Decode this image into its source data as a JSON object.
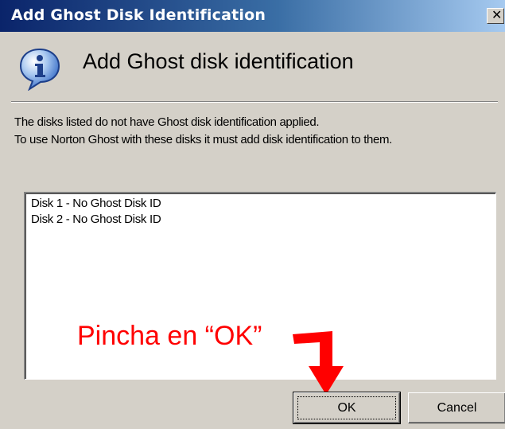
{
  "window": {
    "title": "Add Ghost Disk Identification",
    "close_glyph": "✕"
  },
  "header": {
    "icon": "info-icon",
    "title": "Add Ghost disk identification"
  },
  "description": {
    "line1": "The disks listed do not have Ghost disk identification applied.",
    "line2": "To use Norton Ghost with these disks it must add disk identification to them."
  },
  "disk_list": {
    "items": [
      "Disk 1 - No Ghost Disk ID",
      "Disk 2 - No Ghost Disk ID"
    ]
  },
  "annotation": {
    "text": "Pincha en “OK”",
    "color": "#ff0000"
  },
  "buttons": {
    "ok": "OK",
    "cancel": "Cancel"
  },
  "colors": {
    "titlebar_start": "#0a246a",
    "titlebar_end": "#a6caf0",
    "dialog_bg": "#d4d0c8"
  }
}
